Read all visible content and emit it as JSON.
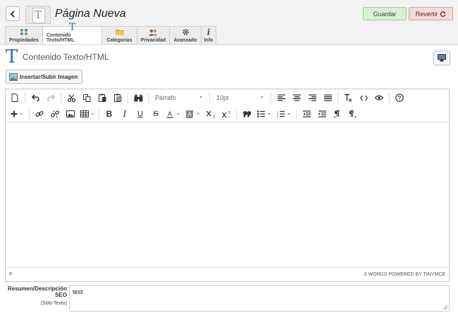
{
  "header": {
    "title": "Página Nueva",
    "save_label": "Guardar",
    "revert_label": "Revertir"
  },
  "tabs": [
    {
      "label": "Propiedades",
      "icon": "properties-icon"
    },
    {
      "label": "Contenido Texto/HTML",
      "icon": "text-T-icon"
    },
    {
      "label": "Categorías",
      "icon": "folder-icon"
    },
    {
      "label": "Privacidad",
      "icon": "users-icon"
    },
    {
      "label": "Avanzado",
      "icon": "gear-icon"
    },
    {
      "label": "Info",
      "icon": "info-icon"
    }
  ],
  "active_tab": "Contenido Texto/HTML",
  "section": {
    "title": "Contenido Texto/HTML",
    "insert_image_label": "Insertar/Subir Imagen"
  },
  "editor": {
    "format_select": "Párrafo",
    "size_select": "10pt",
    "status_path": "P",
    "status_right": "0 WORDS POWERED BY TINYMCE"
  },
  "seo": {
    "label": "Resumen/Descripción SEO",
    "sublabel": "(Sólo Texto)",
    "value": "test"
  },
  "colors": {
    "accent_blue": "#2a67c9",
    "save_bg": "#d9f0d5",
    "revert_bg": "#f7dada"
  }
}
